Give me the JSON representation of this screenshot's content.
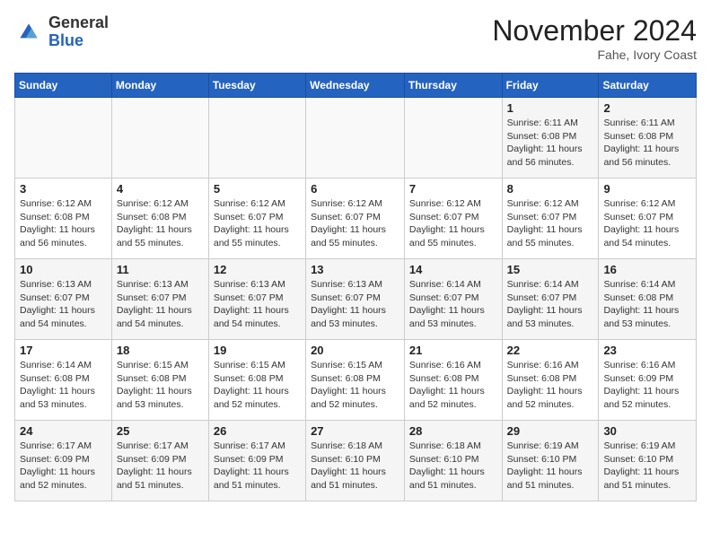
{
  "header": {
    "logo_line1": "General",
    "logo_line2": "Blue",
    "month": "November 2024",
    "location": "Fahe, Ivory Coast"
  },
  "weekdays": [
    "Sunday",
    "Monday",
    "Tuesday",
    "Wednesday",
    "Thursday",
    "Friday",
    "Saturday"
  ],
  "weeks": [
    [
      {
        "day": "",
        "detail": ""
      },
      {
        "day": "",
        "detail": ""
      },
      {
        "day": "",
        "detail": ""
      },
      {
        "day": "",
        "detail": ""
      },
      {
        "day": "",
        "detail": ""
      },
      {
        "day": "1",
        "detail": "Sunrise: 6:11 AM\nSunset: 6:08 PM\nDaylight: 11 hours and 56 minutes."
      },
      {
        "day": "2",
        "detail": "Sunrise: 6:11 AM\nSunset: 6:08 PM\nDaylight: 11 hours and 56 minutes."
      }
    ],
    [
      {
        "day": "3",
        "detail": "Sunrise: 6:12 AM\nSunset: 6:08 PM\nDaylight: 11 hours and 56 minutes."
      },
      {
        "day": "4",
        "detail": "Sunrise: 6:12 AM\nSunset: 6:08 PM\nDaylight: 11 hours and 55 minutes."
      },
      {
        "day": "5",
        "detail": "Sunrise: 6:12 AM\nSunset: 6:07 PM\nDaylight: 11 hours and 55 minutes."
      },
      {
        "day": "6",
        "detail": "Sunrise: 6:12 AM\nSunset: 6:07 PM\nDaylight: 11 hours and 55 minutes."
      },
      {
        "day": "7",
        "detail": "Sunrise: 6:12 AM\nSunset: 6:07 PM\nDaylight: 11 hours and 55 minutes."
      },
      {
        "day": "8",
        "detail": "Sunrise: 6:12 AM\nSunset: 6:07 PM\nDaylight: 11 hours and 55 minutes."
      },
      {
        "day": "9",
        "detail": "Sunrise: 6:12 AM\nSunset: 6:07 PM\nDaylight: 11 hours and 54 minutes."
      }
    ],
    [
      {
        "day": "10",
        "detail": "Sunrise: 6:13 AM\nSunset: 6:07 PM\nDaylight: 11 hours and 54 minutes."
      },
      {
        "day": "11",
        "detail": "Sunrise: 6:13 AM\nSunset: 6:07 PM\nDaylight: 11 hours and 54 minutes."
      },
      {
        "day": "12",
        "detail": "Sunrise: 6:13 AM\nSunset: 6:07 PM\nDaylight: 11 hours and 54 minutes."
      },
      {
        "day": "13",
        "detail": "Sunrise: 6:13 AM\nSunset: 6:07 PM\nDaylight: 11 hours and 53 minutes."
      },
      {
        "day": "14",
        "detail": "Sunrise: 6:14 AM\nSunset: 6:07 PM\nDaylight: 11 hours and 53 minutes."
      },
      {
        "day": "15",
        "detail": "Sunrise: 6:14 AM\nSunset: 6:07 PM\nDaylight: 11 hours and 53 minutes."
      },
      {
        "day": "16",
        "detail": "Sunrise: 6:14 AM\nSunset: 6:08 PM\nDaylight: 11 hours and 53 minutes."
      }
    ],
    [
      {
        "day": "17",
        "detail": "Sunrise: 6:14 AM\nSunset: 6:08 PM\nDaylight: 11 hours and 53 minutes."
      },
      {
        "day": "18",
        "detail": "Sunrise: 6:15 AM\nSunset: 6:08 PM\nDaylight: 11 hours and 53 minutes."
      },
      {
        "day": "19",
        "detail": "Sunrise: 6:15 AM\nSunset: 6:08 PM\nDaylight: 11 hours and 52 minutes."
      },
      {
        "day": "20",
        "detail": "Sunrise: 6:15 AM\nSunset: 6:08 PM\nDaylight: 11 hours and 52 minutes."
      },
      {
        "day": "21",
        "detail": "Sunrise: 6:16 AM\nSunset: 6:08 PM\nDaylight: 11 hours and 52 minutes."
      },
      {
        "day": "22",
        "detail": "Sunrise: 6:16 AM\nSunset: 6:08 PM\nDaylight: 11 hours and 52 minutes."
      },
      {
        "day": "23",
        "detail": "Sunrise: 6:16 AM\nSunset: 6:09 PM\nDaylight: 11 hours and 52 minutes."
      }
    ],
    [
      {
        "day": "24",
        "detail": "Sunrise: 6:17 AM\nSunset: 6:09 PM\nDaylight: 11 hours and 52 minutes."
      },
      {
        "day": "25",
        "detail": "Sunrise: 6:17 AM\nSunset: 6:09 PM\nDaylight: 11 hours and 51 minutes."
      },
      {
        "day": "26",
        "detail": "Sunrise: 6:17 AM\nSunset: 6:09 PM\nDaylight: 11 hours and 51 minutes."
      },
      {
        "day": "27",
        "detail": "Sunrise: 6:18 AM\nSunset: 6:10 PM\nDaylight: 11 hours and 51 minutes."
      },
      {
        "day": "28",
        "detail": "Sunrise: 6:18 AM\nSunset: 6:10 PM\nDaylight: 11 hours and 51 minutes."
      },
      {
        "day": "29",
        "detail": "Sunrise: 6:19 AM\nSunset: 6:10 PM\nDaylight: 11 hours and 51 minutes."
      },
      {
        "day": "30",
        "detail": "Sunrise: 6:19 AM\nSunset: 6:10 PM\nDaylight: 11 hours and 51 minutes."
      }
    ]
  ]
}
